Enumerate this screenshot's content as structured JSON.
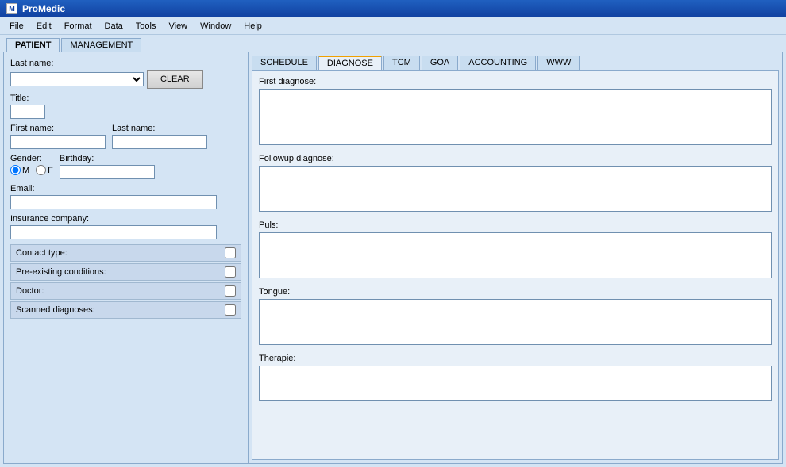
{
  "titleBar": {
    "appName": "ProMedic",
    "icon": "M"
  },
  "menuBar": {
    "items": [
      "File",
      "Edit",
      "Format",
      "Data",
      "Tools",
      "View",
      "Window",
      "Help"
    ]
  },
  "topTabs": {
    "tabs": [
      "PATIENT",
      "MANAGEMENT"
    ],
    "active": "PATIENT"
  },
  "leftPanel": {
    "lastNameLabel": "Last name:",
    "clearButton": "CLEAR",
    "titleLabel": "Title:",
    "firstNameLabel": "First name:",
    "lastNameLabel2": "Last name:",
    "genderLabel": "Gender:",
    "genderMale": "M",
    "genderFemale": "F",
    "birthdayLabel": "Birthday:",
    "emailLabel": "Email:",
    "insuranceLabel": "Insurance company:",
    "contactTypeLabel": "Contact type:",
    "preExistingLabel": "Pre-existing conditions:",
    "doctorLabel": "Doctor:",
    "scannedDiagnosesLabel": "Scanned diagnoses:"
  },
  "diagnoseTabs": {
    "tabs": [
      "SCHEDULE",
      "DIAGNOSE",
      "TCM",
      "GOA",
      "ACCOUNTING",
      "WWW"
    ],
    "active": "DIAGNOSE"
  },
  "diagnoseContent": {
    "firstDiagnoseLabel": "First diagnose:",
    "firstDiagnoseValue": "",
    "followupDiagnoseLabel": "Followup diagnose:",
    "followupDiagnoseValue": "",
    "pulsLabel": "Puls:",
    "pulsValue": "",
    "tongueLabel": "Tongue:",
    "tongueValue": "",
    "therapieLabel": "Therapie:",
    "therapieValue": ""
  }
}
